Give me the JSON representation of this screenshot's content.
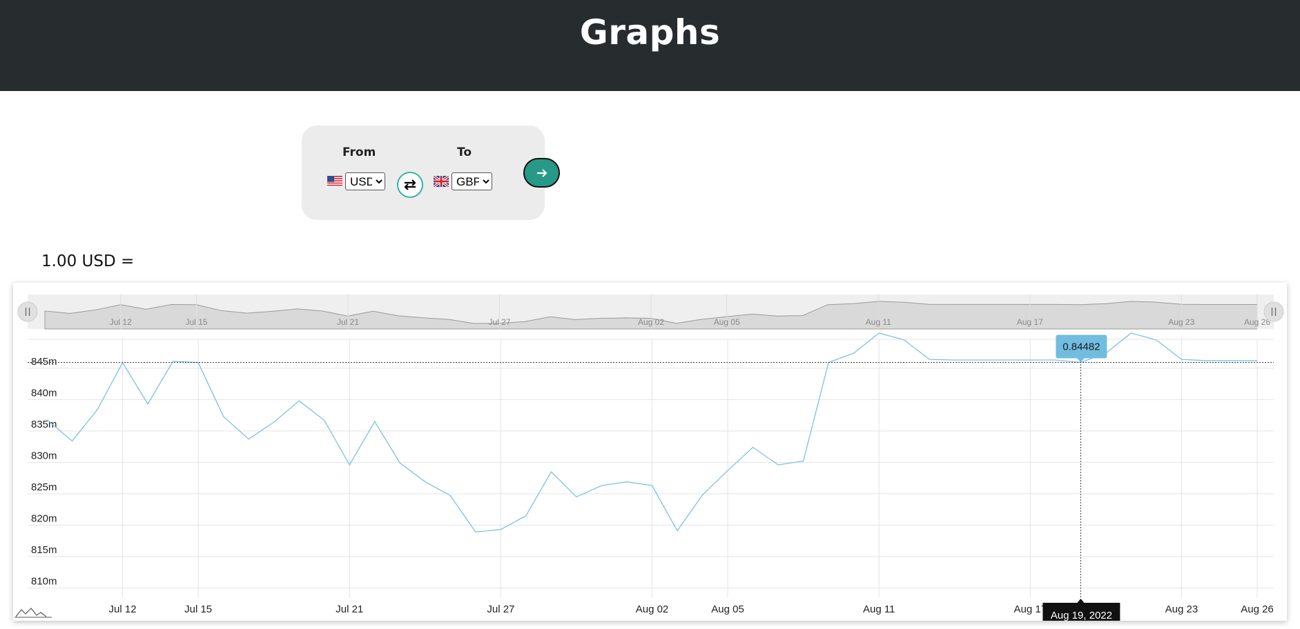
{
  "header": {
    "title": "Graphs"
  },
  "converter": {
    "from_label": "From",
    "to_label": "To",
    "from_currency": "USD",
    "to_currency": "GBP",
    "swap_icon": "swap-arrows-icon",
    "submit_icon": "arrow-right-icon"
  },
  "rate_heading": "1.00 USD =",
  "colors": {
    "line": "#7cc0e3",
    "tooltip_bg": "#71bde0",
    "header_bg": "#272c2e",
    "accent": "#279987"
  },
  "chart_data": {
    "type": "line",
    "x": [
      "2022-07-09",
      "2022-07-10",
      "2022-07-11",
      "2022-07-12",
      "2022-07-13",
      "2022-07-14",
      "2022-07-15",
      "2022-07-16",
      "2022-07-17",
      "2022-07-18",
      "2022-07-19",
      "2022-07-20",
      "2022-07-21",
      "2022-07-22",
      "2022-07-23",
      "2022-07-24",
      "2022-07-25",
      "2022-07-26",
      "2022-07-27",
      "2022-07-28",
      "2022-07-29",
      "2022-07-30",
      "2022-07-31",
      "2022-08-01",
      "2022-08-02",
      "2022-08-03",
      "2022-08-04",
      "2022-08-05",
      "2022-08-06",
      "2022-08-07",
      "2022-08-08",
      "2022-08-09",
      "2022-08-10",
      "2022-08-11",
      "2022-08-12",
      "2022-08-13",
      "2022-08-14",
      "2022-08-15",
      "2022-08-16",
      "2022-08-17",
      "2022-08-18",
      "2022-08-19",
      "2022-08-20",
      "2022-08-21",
      "2022-08-22",
      "2022-08-23",
      "2022-08-24",
      "2022-08-25",
      "2022-08-26"
    ],
    "series": [
      {
        "values": [
          0.8357,
          0.8323,
          0.8373,
          0.8448,
          0.8382,
          0.845,
          0.8448,
          0.8362,
          0.8326,
          0.8353,
          0.8387,
          0.8356,
          0.8285,
          0.8354,
          0.8288,
          0.8258,
          0.8236,
          0.8178,
          0.8182,
          0.8204,
          0.8274,
          0.8234,
          0.8252,
          0.8258,
          0.8252,
          0.818,
          0.8237,
          0.8276,
          0.8313,
          0.8285,
          0.8291,
          0.84482,
          0.8463,
          0.8495,
          0.8484,
          0.8453,
          0.8452,
          0.8452,
          0.8452,
          0.8452,
          0.8452,
          0.84482,
          0.8463,
          0.8495,
          0.8484,
          0.8453,
          0.8451,
          0.8451,
          0.8451
        ]
      }
    ],
    "x_tick_labels": [
      "Jul 12",
      "Jul 15",
      "Jul 21",
      "Jul 27",
      "Aug 02",
      "Aug 05",
      "Aug 11",
      "Aug 17",
      "Aug 23",
      "Aug 26"
    ],
    "y_tick_labels": [
      "810m",
      "815m",
      "820m",
      "825m",
      "830m",
      "835m",
      "840m",
      "845m"
    ],
    "ylim": [
      0.8085,
      0.8485
    ],
    "grid": true,
    "crosshair": {
      "date_label": "Aug 19, 2022",
      "value_label": "0.84482"
    },
    "navigator_labels": [
      "Jul 12",
      "Jul 15",
      "Jul 21",
      "Jul 27",
      "Aug 02",
      "Aug 05",
      "Aug 11",
      "Aug 17",
      "Aug 23",
      "Aug 26"
    ]
  }
}
